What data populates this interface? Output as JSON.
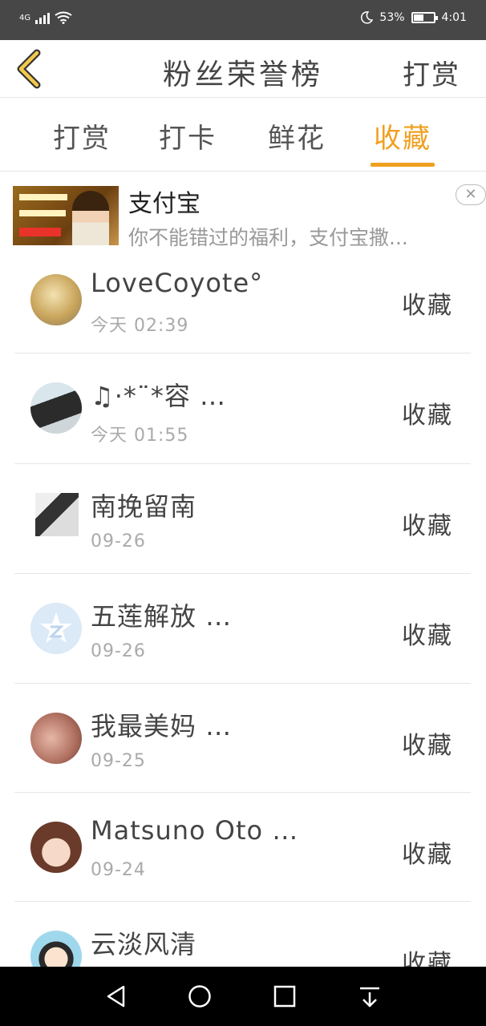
{
  "status_bar": {
    "network": "4G",
    "battery": "53%",
    "time": "4:01",
    "battery_level": 0.53
  },
  "header": {
    "title": "粉丝荣誉榜",
    "right_action": "打赏"
  },
  "tabs": [
    {
      "label": "打赏"
    },
    {
      "label": "打卡"
    },
    {
      "label": "鲜花"
    },
    {
      "label": "收藏",
      "active": true
    }
  ],
  "ad": {
    "title": "支付宝",
    "description": "你不能错过的福利，支付宝撒...",
    "close": "✕"
  },
  "list": [
    {
      "name": "LoveCoyote°",
      "date": "今天 02:39",
      "action": "收藏"
    },
    {
      "name": "♫·*¨*容 …",
      "date": "今天 01:55",
      "action": "收藏"
    },
    {
      "name": "南挽留南",
      "date": "09-26",
      "action": "收藏"
    },
    {
      "name": "五莲解放 …",
      "date": "09-26",
      "action": "收藏"
    },
    {
      "name": "我最美妈 …",
      "date": "09-25",
      "action": "收藏"
    },
    {
      "name": "Matsuno Oto …",
      "date": "09-24",
      "action": "收藏"
    },
    {
      "name": "云淡风清",
      "date": "",
      "action": "收藏"
    }
  ],
  "colors": {
    "accent": "#f0a020",
    "status_bar": "#474747",
    "nav_bar": "#000000"
  }
}
